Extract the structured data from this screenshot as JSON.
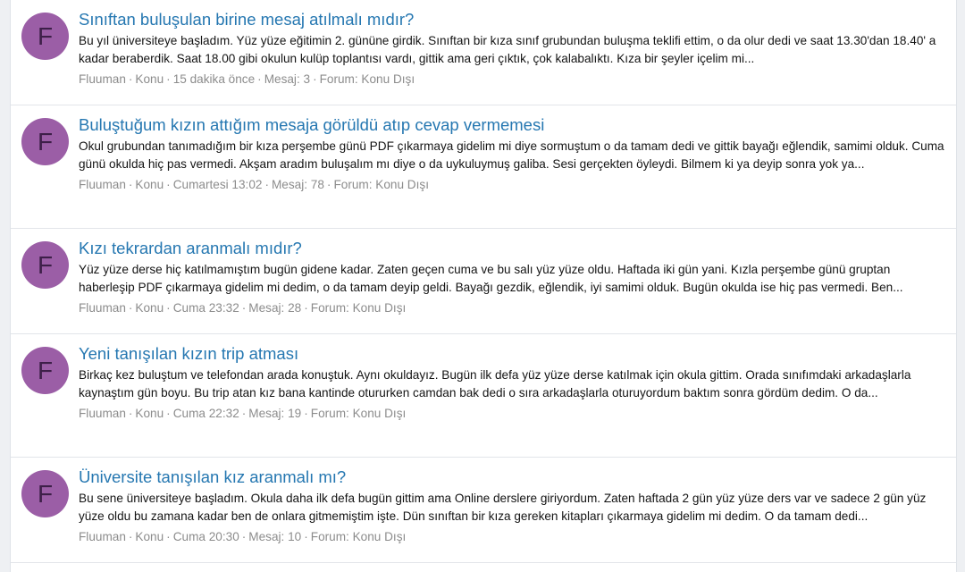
{
  "colors": {
    "title": "#2577b1",
    "avatar_bg": "#9b5ea6",
    "meta": "#8c8c8c"
  },
  "results": [
    {
      "avatar_letter": "F",
      "title": "Sınıftan buluşulan birine mesaj atılmalı mıdır?",
      "snippet": "Bu yıl üniversiteye başladım. Yüz yüze eğitimin 2. gününe girdik. Sınıftan bir kıza sınıf grubundan buluşma teklifi ettim, o da olur dedi ve saat 13.30'dan 18.40' a kadar beraberdik. Saat 18.00 gibi okulun kulüp toplantısı vardı, gittik ama geri çıktık, çok kalabalıktı. Kıza bir şeyler içelim mi...",
      "author": "Fluuman",
      "type": "Konu",
      "time": "15 dakika önce",
      "replies": "Mesaj: 3",
      "forum": "Forum: Konu Dışı"
    },
    {
      "avatar_letter": "F",
      "title": "Buluştuğum kızın attığım mesaja görüldü atıp cevap vermemesi",
      "snippet": "Okul grubundan tanımadığım bir kıza perşembe günü PDF çıkarmaya gidelim mi diye sormuştum o da tamam dedi ve gittik bayağı eğlendik, samimi olduk. Cuma günü okulda hiç pas vermedi. Akşam aradım buluşalım mı diye o da uykuluymuş galiba. Sesi gerçekten öyleydi. Bilmem ki ya deyip sonra yok ya...",
      "author": "Fluuman",
      "type": "Konu",
      "time": "Cumartesi 13:02",
      "replies": "Mesaj: 78",
      "forum": "Forum: Konu Dışı"
    },
    {
      "avatar_letter": "F",
      "title": "Kızı tekrardan aranmalı mıdır?",
      "snippet": "Yüz yüze derse hiç katılmamıştım bugün gidene kadar. Zaten geçen cuma ve bu salı yüz yüze oldu. Haftada iki gün yani. Kızla perşembe günü gruptan haberleşip PDF çıkarmaya gidelim mi dedim, o da tamam deyip geldi. Bayağı gezdik, eğlendik, iyi samimi olduk. Bugün okulda ise hiç pas vermedi. Ben...",
      "author": "Fluuman",
      "type": "Konu",
      "time": "Cuma 23:32",
      "replies": "Mesaj: 28",
      "forum": "Forum: Konu Dışı"
    },
    {
      "avatar_letter": "F",
      "title": "Yeni tanışılan kızın trip atması",
      "snippet": "Birkaç kez buluştum ve telefondan arada konuştuk. Aynı okuldayız. Bugün ilk defa yüz yüze derse katılmak için okula gittim. Orada sınıfımdaki arkadaşlarla kaynaştım gün boyu. Bu trip atan kız bana kantinde otururken camdan bak dedi o sıra arkadaşlarla oturuyordum baktım sonra gördüm dedim. O da...",
      "author": "Fluuman",
      "type": "Konu",
      "time": "Cuma 22:32",
      "replies": "Mesaj: 19",
      "forum": "Forum: Konu Dışı"
    },
    {
      "avatar_letter": "F",
      "title": "Üniversite tanışılan kız aranmalı mı?",
      "snippet": "Bu sene üniversiteye başladım. Okula daha ilk defa bugün gittim ama Online derslere giriyordum. Zaten haftada 2 gün yüz yüze ders var ve sadece 2 gün yüz yüze oldu bu zamana kadar ben de onlara gitmemiştim işte. Dün sınıftan bir kıza gereken kitapları çıkarmaya gidelim mi dedim. O da tamam dedi...",
      "author": "Fluuman",
      "type": "Konu",
      "time": "Cuma 20:30",
      "replies": "Mesaj: 10",
      "forum": "Forum: Konu Dışı"
    }
  ]
}
